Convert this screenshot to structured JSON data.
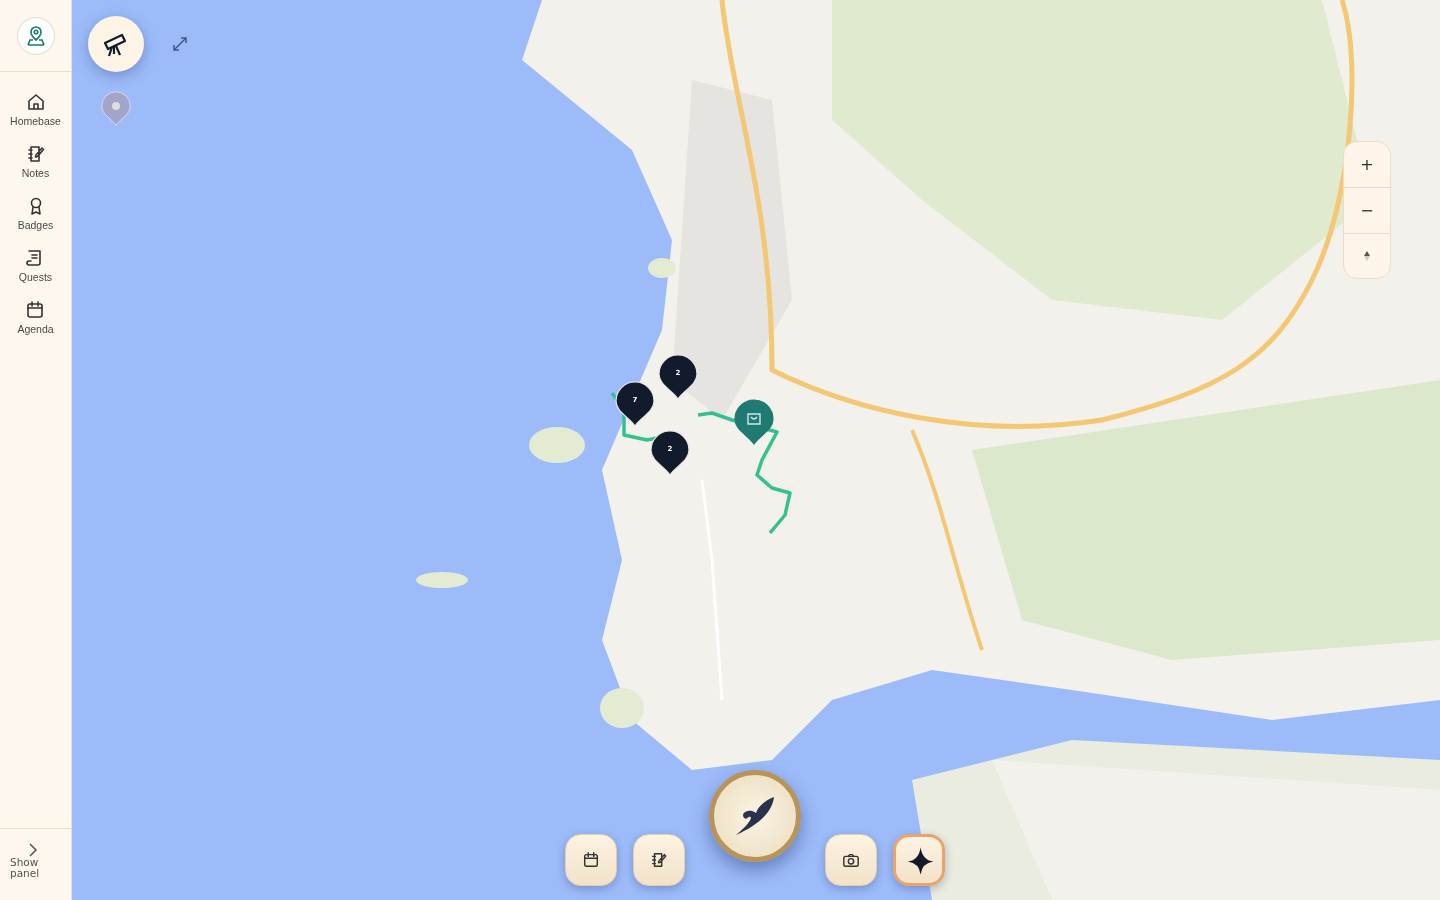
{
  "sidebar": {
    "logo": {
      "kind": "location"
    },
    "items": [
      {
        "label": "Homebase",
        "kind": "home"
      },
      {
        "label": "Notes",
        "kind": "notes"
      },
      {
        "label": "Badges",
        "kind": "badge"
      },
      {
        "label": "Quests",
        "kind": "scroll"
      },
      {
        "label": "Agenda",
        "kind": "calendar"
      }
    ],
    "toggle": {
      "label": "Show panel"
    }
  },
  "map": {
    "kind": "picture",
    "markers": [
      {
        "kind": "pin"
      },
      {
        "kind": "cluster",
        "count": "2"
      },
      {
        "kind": "cluster",
        "count": "7"
      },
      {
        "kind": "cluster",
        "count": "2"
      },
      {
        "kind": "shop"
      }
    ],
    "zoom_controls": [
      "+",
      "−"
    ]
  },
  "toolbar": [
    {
      "kind": "calendar"
    },
    {
      "kind": "notes"
    },
    {
      "kind": "compass"
    },
    {
      "kind": "camera"
    },
    {
      "kind": "sparkle"
    }
  ]
}
